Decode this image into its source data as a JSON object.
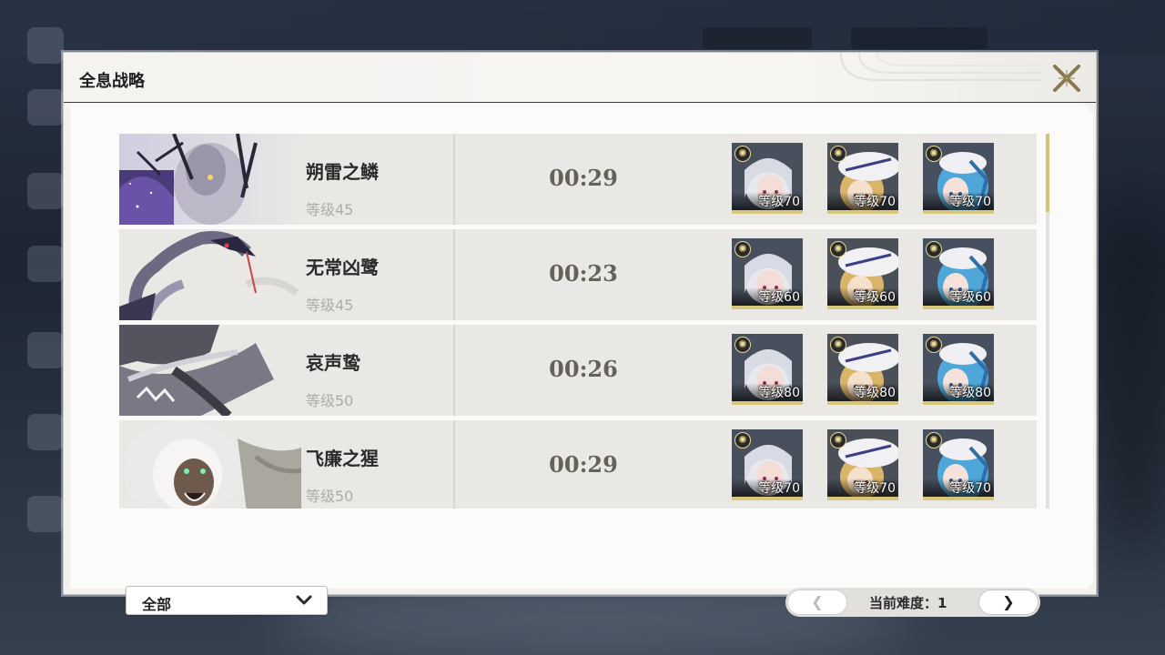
{
  "window": {
    "title": "全息战略",
    "close_icon": "close-x-icon"
  },
  "bosses": [
    {
      "name": "朔雷之鳞",
      "level": "等级45",
      "time": "00:29",
      "team": [
        {
          "level": "等级70",
          "char": "silver-hair",
          "element": "sun-icon"
        },
        {
          "level": "等级70",
          "char": "blonde-hat",
          "element": "sun-icon"
        },
        {
          "level": "等级70",
          "char": "blue-hair",
          "element": "sun-icon"
        }
      ]
    },
    {
      "name": "无常凶鹭",
      "level": "等级45",
      "time": "00:23",
      "team": [
        {
          "level": "等级60",
          "char": "silver-hair",
          "element": "sun-icon"
        },
        {
          "level": "等级60",
          "char": "blonde-hat",
          "element": "sun-icon"
        },
        {
          "level": "等级60",
          "char": "blue-hair",
          "element": "sun-icon"
        }
      ]
    },
    {
      "name": "哀声鸷",
      "level": "等级50",
      "time": "00:26",
      "team": [
        {
          "level": "等级80",
          "char": "silver-hair",
          "element": "sun-icon"
        },
        {
          "level": "等级80",
          "char": "blonde-hat",
          "element": "sun-icon"
        },
        {
          "level": "等级80",
          "char": "blue-hair",
          "element": "sun-icon"
        }
      ]
    },
    {
      "name": "飞廉之猩",
      "level": "等级50",
      "time": "00:29",
      "team": [
        {
          "level": "等级70",
          "char": "silver-hair",
          "element": "sun-icon"
        },
        {
          "level": "等级70",
          "char": "blonde-hat",
          "element": "sun-icon"
        },
        {
          "level": "等级70",
          "char": "blue-hair",
          "element": "sun-icon"
        }
      ]
    }
  ],
  "filter": {
    "selected": "全部",
    "icon": "chevron-down-icon"
  },
  "difficulty": {
    "prev_label": "❮",
    "next_label": "❯",
    "label": "当前难度：1"
  },
  "colors": {
    "accent_gold": "#d6c77a",
    "panel_bg": "#f2f1ee",
    "row_bg": "#e9e8e5"
  }
}
